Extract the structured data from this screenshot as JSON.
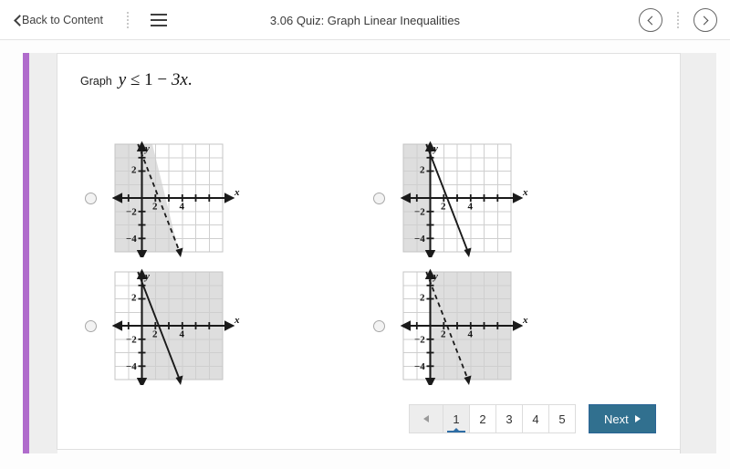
{
  "header": {
    "back_label": "Back to Content",
    "title": "3.06 Quiz: Graph Linear Inequalities",
    "menu_icon": "hamburger-menu-icon",
    "prev_icon": "chevron-left-circle-icon",
    "next_icon": "chevron-right-circle-icon",
    "back_icon": "chevron-left-icon"
  },
  "question": {
    "prefix": "Graph",
    "expression": "y ≤ 1 − 3x.",
    "variable_y": "y",
    "relation": "≤",
    "intercept": "1",
    "minus": "−",
    "slope_term": "3x",
    "period": "."
  },
  "chart_data": {
    "type": "line",
    "title": "Graph y ≤ 1 − 3x.",
    "xlabel": "x",
    "ylabel": "y",
    "xlim": [
      -2,
      6
    ],
    "ylim": [
      -5,
      3
    ],
    "grid": true,
    "xticks": [
      2,
      4
    ],
    "yticks": [
      2,
      -2,
      -4
    ],
    "boundary_line": {
      "slope": -3,
      "intercept": 1,
      "equation": "y = 1 - 3x"
    },
    "options": [
      {
        "id": "A",
        "line_style": "dashed",
        "line_slope": -3,
        "line_intercept": 1,
        "shading": "left-of-line",
        "shade_description": "Region to the left of the dashed boundary line is shaded."
      },
      {
        "id": "B",
        "line_style": "solid",
        "line_slope": -3,
        "line_intercept": 1,
        "shading": "left-of-y-axis",
        "shade_description": "Region left of the y-axis is shaded; boundary line is solid."
      },
      {
        "id": "C",
        "line_style": "solid",
        "line_slope": -3,
        "line_intercept": 1,
        "shading": "right-of-y-axis",
        "shade_description": "Region right of the y-axis is shaded; boundary line is solid."
      },
      {
        "id": "D",
        "line_style": "dashed",
        "line_slope": -3,
        "line_intercept": 1,
        "shading": "right-of-y-axis",
        "shade_description": "Region right of the y-axis is shaded; boundary line is dashed."
      }
    ]
  },
  "pagination": {
    "prev_label": "◂",
    "pages": [
      "1",
      "2",
      "3",
      "4",
      "5"
    ],
    "active_page": "1",
    "next_label": "Next"
  },
  "colors": {
    "accent_purple": "#b06ccc",
    "button_blue": "#31708f",
    "active_underline": "#2e6da4",
    "graph_shade": "#dedede",
    "rail_gray": "#eeeeee"
  }
}
